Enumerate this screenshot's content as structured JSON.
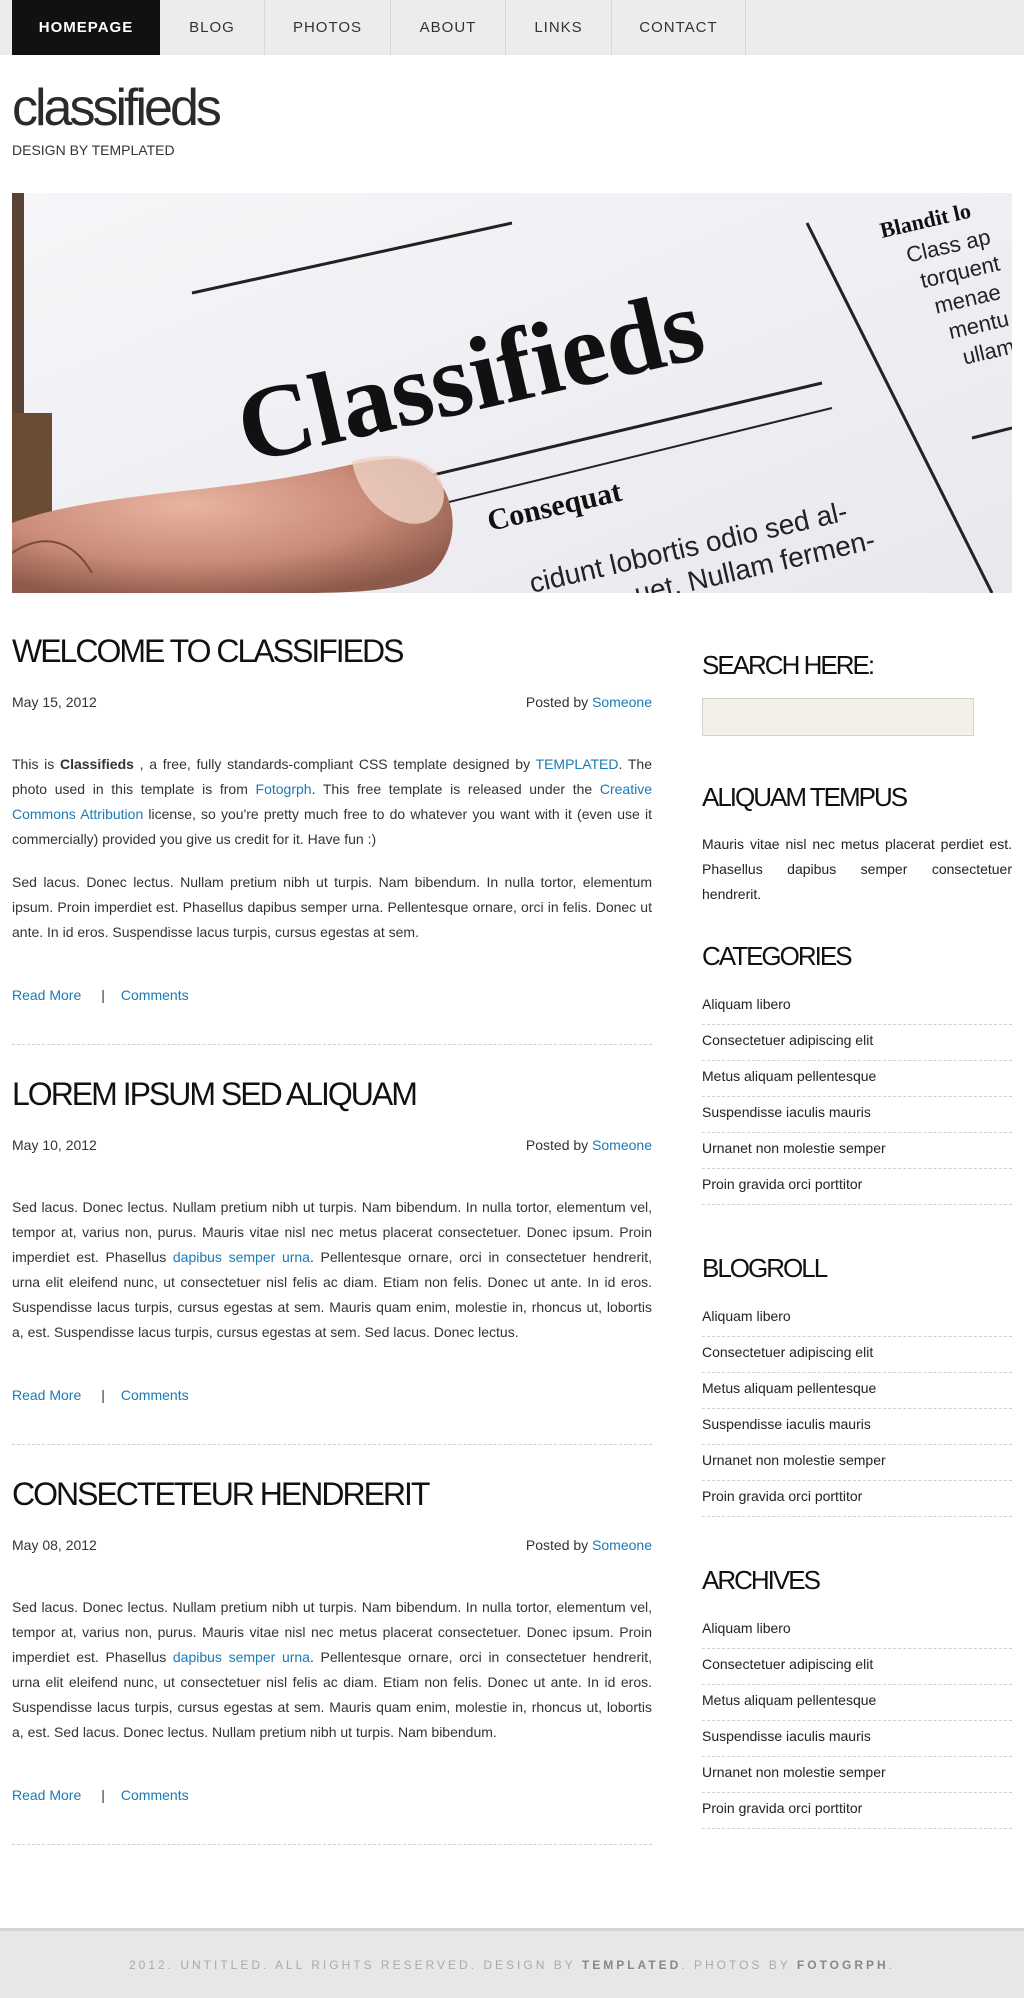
{
  "nav": {
    "items": [
      {
        "label": "HOMEPAGE"
      },
      {
        "label": "BLOG"
      },
      {
        "label": "PHOTOS"
      },
      {
        "label": "ABOUT"
      },
      {
        "label": "LINKS"
      },
      {
        "label": "CONTACT"
      }
    ],
    "active_index": 0
  },
  "logo": {
    "title": "classifieds",
    "tagline": "DESIGN BY TEMPLATED"
  },
  "banner": {
    "headline": "Classifieds",
    "subhead": "Consequat",
    "body_line1": "cidunt lobortis odio sed al-",
    "body_line2": "uet. Nullam fermen-",
    "side_title": "Blandit lo",
    "side_lines": [
      "Class ap",
      "torquent",
      "menae",
      "mentu",
      "ullam"
    ]
  },
  "posts": [
    {
      "title": "WELCOME TO CLASSIFIEDS",
      "date": "May 15, 2012",
      "posted_by": "Posted by",
      "author": "Someone",
      "p1": {
        "t1": "This is ",
        "bold": "Classifieds",
        "t2": " , a free, fully standards-compliant CSS template designed by ",
        "link1": "TEMPLATED",
        "t3": ". The photo used in this template is from ",
        "link2": "Fotogrph",
        "t4": ". This free template is released under the ",
        "link3": "Creative Commons Attribution",
        "t5": " license, so you're pretty much free to do whatever you want with it (even use it commercially) provided you give us credit for it. Have fun :)"
      },
      "p2": "Sed lacus. Donec lectus. Nullam pretium nibh ut turpis. Nam bibendum. In nulla tortor, elementum ipsum. Proin imperdiet est. Phasellus dapibus semper urna. Pellentesque ornare, orci in felis. Donec ut ante. In id eros. Suspendisse lacus turpis, cursus egestas at sem.",
      "read_more": "Read More",
      "separator": "|",
      "comments": "Comments"
    },
    {
      "title": "LOREM IPSUM SED ALIQUAM",
      "date": "May 10, 2012",
      "posted_by": "Posted by",
      "author": "Someone",
      "t1": "Sed lacus. Donec lectus. Nullam pretium nibh ut turpis. Nam bibendum. In nulla tortor, elementum vel, tempor at, varius non, purus. Mauris vitae nisl nec metus placerat consectetuer. Donec ipsum. Proin imperdiet est. Phasellus ",
      "link": "dapibus semper urna",
      "t2": ". Pellentesque ornare, orci in consectetuer hendrerit, urna elit eleifend nunc, ut consectetuer nisl felis ac diam. Etiam non felis. Donec ut ante. In id eros. Suspendisse lacus turpis, cursus egestas at sem. Mauris quam enim, molestie in, rhoncus ut, lobortis a, est. Suspendisse lacus turpis, cursus egestas at sem. Sed lacus. Donec lectus.",
      "read_more": "Read More",
      "separator": "|",
      "comments": "Comments"
    },
    {
      "title": "CONSECTETEUR HENDRERIT",
      "date": "May 08, 2012",
      "posted_by": "Posted by",
      "author": "Someone",
      "t1": "Sed lacus. Donec lectus. Nullam pretium nibh ut turpis. Nam bibendum. In nulla tortor, elementum vel, tempor at, varius non, purus. Mauris vitae nisl nec metus placerat consectetuer. Donec ipsum. Proin imperdiet est. Phasellus ",
      "link": "dapibus semper urna",
      "t2": ". Pellentesque ornare, orci in consectetuer hendrerit, urna elit eleifend nunc, ut consectetuer nisl felis ac diam. Etiam non felis. Donec ut ante. In id eros. Suspendisse lacus turpis, cursus egestas at sem. Mauris quam enim, molestie in, rhoncus ut, lobortis a, est. Sed lacus. Donec lectus. Nullam pretium nibh ut turpis. Nam bibendum.",
      "read_more": "Read More",
      "separator": "|",
      "comments": "Comments"
    }
  ],
  "sidebar": {
    "search_title": "SEARCH HERE:",
    "tempus_title": "ALIQUAM TEMPUS",
    "tempus_text": "Mauris vitae nisl nec metus placerat perdiet est. Phasellus dapibus semper consectetuer hendrerit.",
    "categories_title": "CATEGORIES",
    "blogroll_title": "BLOGROLL",
    "archives_title": "ARCHIVES",
    "list_items": [
      "Aliquam libero",
      "Consectetuer adipiscing elit",
      "Metus aliquam pellentesque",
      "Suspendisse iaculis mauris",
      "Urnanet non molestie semper",
      "Proin gravida orci porttitor"
    ]
  },
  "footer": {
    "t1": "2012. UNTITLED. ALL RIGHTS RESERVED. DESIGN BY ",
    "brand1": "TEMPLATED",
    "t2": ". PHOTOS BY ",
    "brand2": "FOTOGRPH",
    "t3": "."
  }
}
